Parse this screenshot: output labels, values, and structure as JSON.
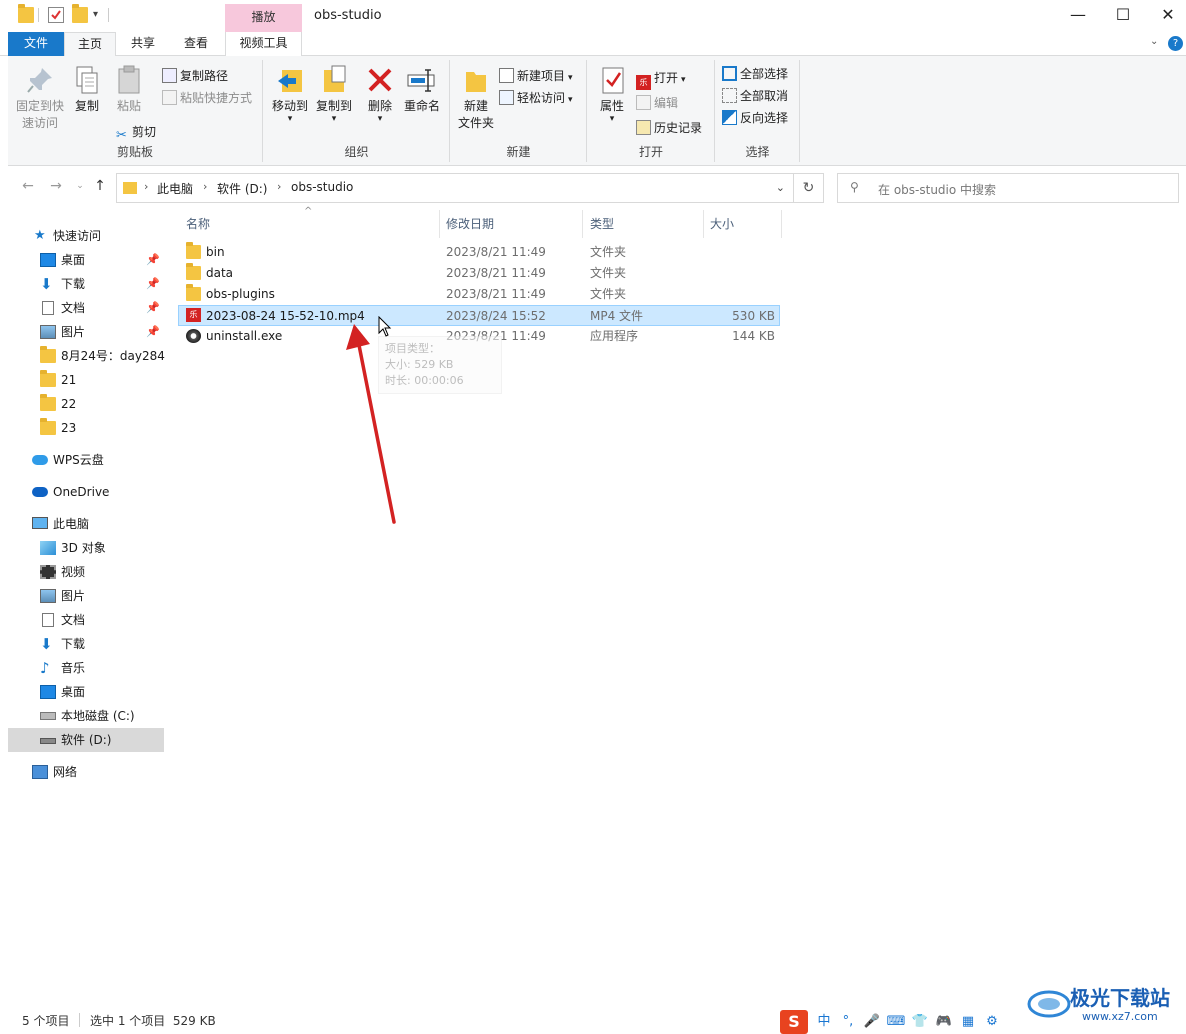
{
  "window": {
    "title": "obs-studio",
    "context_tab_top": "播放",
    "minimize": "—",
    "maximize": "☐",
    "close": "✕"
  },
  "ribbon_tabs": [
    "文件",
    "主页",
    "共享",
    "查看",
    "视频工具"
  ],
  "ribbon": {
    "clipboard": {
      "label": "剪贴板",
      "pin": "固定到快速访问",
      "pin_line1": "固定到快",
      "pin_line2": "速访问",
      "copy": "复制",
      "paste": "粘贴",
      "copy_path": "复制路径",
      "paste_shortcut": "粘贴快捷方式",
      "cut": "剪切"
    },
    "organize": {
      "label": "组织",
      "move_to": "移动到",
      "copy_to": "复制到",
      "delete": "删除",
      "rename": "重命名"
    },
    "new": {
      "label": "新建",
      "new_folder_line1": "新建",
      "new_folder_line2": "文件夹",
      "new_item": "新建项目",
      "easy_access": "轻松访问"
    },
    "open": {
      "label": "打开",
      "properties": "属性",
      "open": "打开",
      "edit": "编辑",
      "history": "历史记录"
    },
    "select": {
      "label": "选择",
      "select_all": "全部选择",
      "select_none": "全部取消",
      "invert": "反向选择"
    }
  },
  "address": {
    "crumbs": [
      "此电脑",
      "软件 (D:)",
      "obs-studio"
    ],
    "search_placeholder": "在 obs-studio 中搜索"
  },
  "nav": {
    "quick_access": "快速访问",
    "quick_items": [
      "桌面",
      "下载",
      "文档",
      "图片",
      "8月24号：day284",
      "21",
      "22",
      "23"
    ],
    "wps": "WPS云盘",
    "onedrive": "OneDrive",
    "this_pc": "此电脑",
    "pc_items": [
      "3D 对象",
      "视频",
      "图片",
      "文档",
      "下载",
      "音乐",
      "桌面",
      "本地磁盘 (C:)",
      "软件 (D:)"
    ],
    "network": "网络"
  },
  "columns": {
    "name": "名称",
    "modified": "修改日期",
    "type": "类型",
    "size": "大小"
  },
  "files": [
    {
      "name": "bin",
      "modified": "2023/8/21 11:49",
      "type": "文件夹",
      "size": "",
      "icon": "folder-icon"
    },
    {
      "name": "data",
      "modified": "2023/8/21 11:49",
      "type": "文件夹",
      "size": "",
      "icon": "folder-icon"
    },
    {
      "name": "obs-plugins",
      "modified": "2023/8/21 11:49",
      "type": "文件夹",
      "size": "",
      "icon": "folder-icon"
    },
    {
      "name": "2023-08-24 15-52-10.mp4",
      "modified": "2023/8/24 15:52",
      "type": "MP4 文件",
      "size": "530 KB",
      "icon": "video-file-icon",
      "selected": true
    },
    {
      "name": "uninstall.exe",
      "modified": "2023/8/21 11:49",
      "type": "应用程序",
      "size": "144 KB",
      "icon": "exe-icon"
    }
  ],
  "tooltip": {
    "line1": "项目类型：",
    "line2": "大小: 529 KB",
    "line3": "时长: 00:00:06"
  },
  "status": {
    "count": "5 个项目",
    "selected": "选中 1 个项目  529 KB"
  },
  "taskbar": {
    "ime_mode": "中",
    "ime_punct": "°,"
  },
  "watermark": {
    "name": "极光下载站",
    "url": "www.xz7.com"
  },
  "colors": {
    "accent": "#1979ca",
    "selection": "#cce8ff",
    "context_tab": "#f7c8dc",
    "arrow": "#d32222"
  }
}
